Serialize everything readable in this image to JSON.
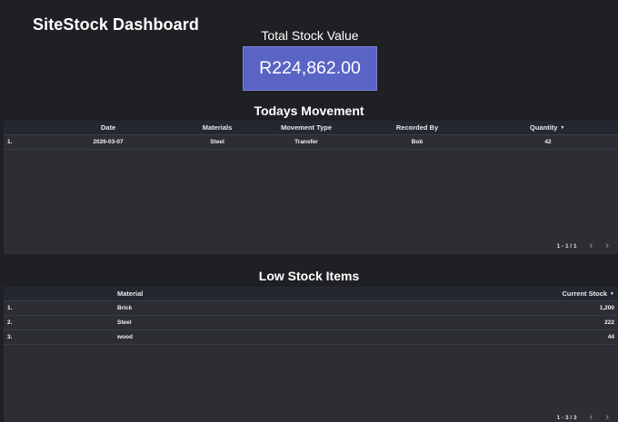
{
  "app": {
    "title": "SiteStock Dashboard"
  },
  "kpi": {
    "label": "Total Stock Value",
    "value": "R224,862.00",
    "color": "#5a64c4"
  },
  "movement": {
    "title": "Todays Movement",
    "columns": [
      "Date",
      "Materials",
      "Movement Type",
      "Recorded By",
      "Quantity"
    ],
    "rows": [
      {
        "index": "1.",
        "date": "2026-03-07",
        "material": "Steel",
        "type": "Transfer",
        "recorded_by": "Bob",
        "quantity": "42"
      }
    ],
    "pagination": "1 - 1 / 1"
  },
  "lowstock": {
    "title": "Low Stock Items",
    "columns": [
      "Material",
      "Current Stock"
    ],
    "rows": [
      {
        "index": "1.",
        "material": "Brick",
        "stock": "1,200"
      },
      {
        "index": "2.",
        "material": "Steel",
        "stock": "222"
      },
      {
        "index": "3.",
        "material": "wood",
        "stock": "44"
      }
    ],
    "pagination": "1 - 3 / 3"
  },
  "icons": {
    "sort": "sort-desc-icon",
    "prev": "chevron-left-icon",
    "next": "chevron-right-icon"
  }
}
